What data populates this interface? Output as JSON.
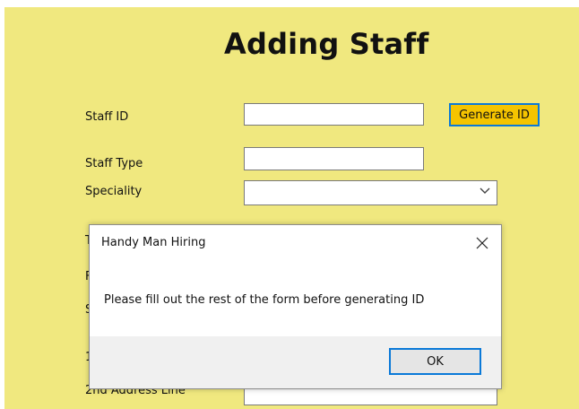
{
  "form": {
    "title": "Adding Staff",
    "labels": {
      "staff_id": "Staff ID",
      "staff_type": "Staff Type",
      "speciality": "Speciality",
      "partial_t1": "T",
      "partial_f": "F",
      "partial_s": "S",
      "partial_t2": "1",
      "second_address": "2nd Address Line"
    },
    "fields": {
      "staff_id_value": "",
      "staff_type_value": "",
      "speciality_selected": ""
    },
    "generate_button": "Generate ID",
    "colors": {
      "background": "#f0e87f",
      "button": "#f5c400",
      "focus_border": "#0a79d8"
    }
  },
  "dialog": {
    "title": "Handy Man Hiring",
    "message": "Please fill out the rest of the form before generating ID",
    "ok_button": "OK",
    "close_icon": "close-icon"
  }
}
